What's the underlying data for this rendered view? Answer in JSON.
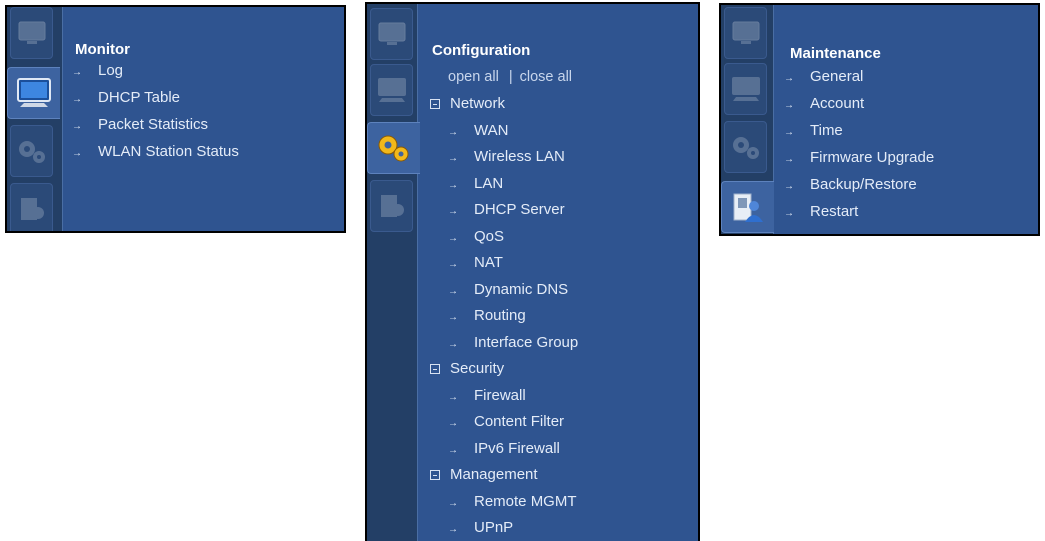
{
  "monitor": {
    "title": "Monitor",
    "items": [
      "Log",
      "DHCP Table",
      "Packet Statistics",
      "WLAN Station Status"
    ]
  },
  "configuration": {
    "title": "Configuration",
    "open_all": "open all",
    "separator": "|",
    "close_all": "close all",
    "groups": [
      {
        "label": "Network",
        "items": [
          "WAN",
          "Wireless LAN",
          "LAN",
          "DHCP Server",
          "QoS",
          "NAT",
          "Dynamic DNS",
          "Routing",
          "Interface Group"
        ]
      },
      {
        "label": "Security",
        "items": [
          "Firewall",
          "Content Filter",
          "IPv6 Firewall"
        ]
      },
      {
        "label": "Management",
        "items": [
          "Remote MGMT",
          "UPnP"
        ]
      }
    ]
  },
  "maintenance": {
    "title": "Maintenance",
    "items": [
      "General",
      "Account",
      "Time",
      "Firmware Upgrade",
      "Backup/Restore",
      "Restart"
    ]
  },
  "icons": {
    "arrow": "→",
    "tabs": [
      "status-icon",
      "monitor-icon",
      "configuration-gears-icon",
      "maintenance-icon"
    ]
  },
  "colors": {
    "panel": "#2f5490",
    "tabstrip": "#233f66",
    "text": "#e4ecf8",
    "border": "#000000"
  }
}
